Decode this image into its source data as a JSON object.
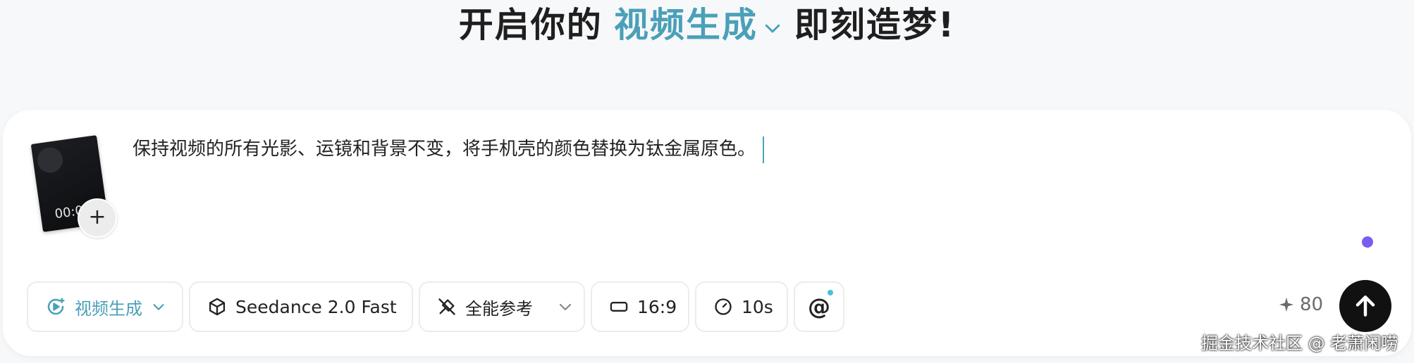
{
  "headline": {
    "prefix": "开启你的",
    "mode": "视频生成",
    "suffix": "即刻造梦!"
  },
  "attachment": {
    "timecode": "00:0",
    "add_label": "+"
  },
  "prompt": {
    "text": "保持视频的所有光影、运镜和背景不变，将手机壳的颜色替换为钛金属原色。"
  },
  "toolbar": {
    "mode_label": "视频生成",
    "model_label": "Seedance 2.0 Fast",
    "reference_label": "全能参考",
    "ratio_label": "16:9",
    "duration_label": "10s",
    "mention_label": "@"
  },
  "credits": {
    "icon": "sparkle-icon",
    "value": "80"
  },
  "watermark": "掘金技术社区 @ 老萧闲唠",
  "colors": {
    "accent": "#4aa0b8",
    "status_dot": "#7a5cf0",
    "send_button": "#111111"
  }
}
